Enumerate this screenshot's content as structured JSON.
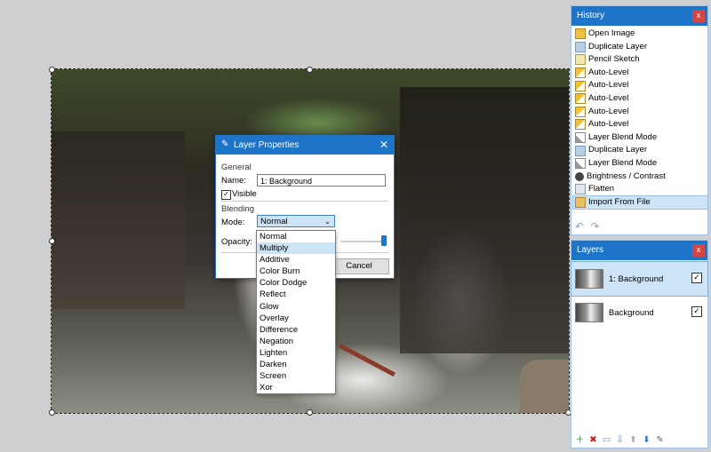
{
  "history": {
    "title": "History",
    "close": "x",
    "items": [
      {
        "label": "Open Image",
        "icon": "open-icon"
      },
      {
        "label": "Duplicate Layer",
        "icon": "duplicate-layer-icon"
      },
      {
        "label": "Pencil Sketch",
        "icon": "pencil-icon"
      },
      {
        "label": "Auto-Level",
        "icon": "auto-level-icon"
      },
      {
        "label": "Auto-Level",
        "icon": "auto-level-icon"
      },
      {
        "label": "Auto-Level",
        "icon": "auto-level-icon"
      },
      {
        "label": "Auto-Level",
        "icon": "auto-level-icon"
      },
      {
        "label": "Auto-Level",
        "icon": "auto-level-icon"
      },
      {
        "label": "Layer Blend Mode",
        "icon": "blend-mode-icon"
      },
      {
        "label": "Duplicate Layer",
        "icon": "duplicate-layer-icon"
      },
      {
        "label": "Layer Blend Mode",
        "icon": "blend-mode-icon"
      },
      {
        "label": "Brightness / Contrast",
        "icon": "brightness-icon"
      },
      {
        "label": "Flatten",
        "icon": "flatten-icon"
      },
      {
        "label": "Import From File",
        "icon": "import-icon"
      }
    ],
    "undo": "↶",
    "redo": "↷"
  },
  "layers": {
    "title": "Layers",
    "close": "x",
    "items": [
      {
        "label": "1: Background",
        "checked": "✓"
      },
      {
        "label": "Background",
        "checked": "✓"
      }
    ],
    "tools": [
      "＋",
      "✖",
      "▭",
      "⇩",
      "⬆",
      "⬇",
      "✎"
    ]
  },
  "dialog": {
    "title": "Layer Properties",
    "close": "✕",
    "general": "General",
    "name_label": "Name:",
    "name_value": "1: Background",
    "visible_label": "Visible",
    "visible_check": "✓",
    "blending": "Blending",
    "mode_label": "Mode:",
    "mode_value": "Normal",
    "opacity_label": "Opacity:",
    "cancel": "Cancel",
    "modes": [
      "Normal",
      "Multiply",
      "Additive",
      "Color Burn",
      "Color Dodge",
      "Reflect",
      "Glow",
      "Overlay",
      "Difference",
      "Negation",
      "Lighten",
      "Darken",
      "Screen",
      "Xor"
    ],
    "highlighted_mode": "Multiply"
  },
  "colors": {
    "accent": "#1e74c9",
    "selection": "#cde4f7",
    "close": "#d64545"
  }
}
